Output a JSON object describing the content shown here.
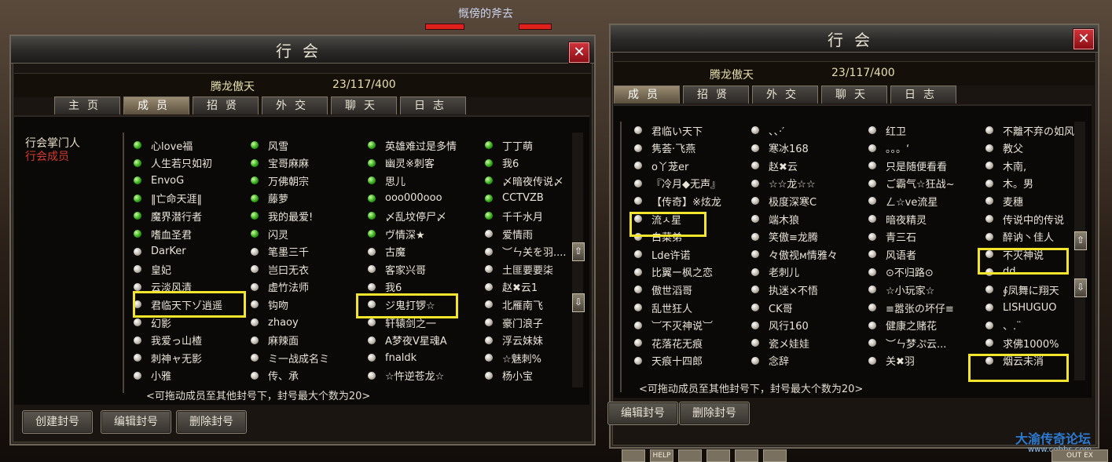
{
  "top_character_name": "慨傍的斧去",
  "left": {
    "title": "行会",
    "close": "✕",
    "guild_name": "腾龙傲天",
    "guild_count": "23/117/400",
    "tabs": [
      "主页",
      "成员",
      "招贤",
      "外交",
      "聊天",
      "日志"
    ],
    "roles": {
      "leader": "行会掌门人",
      "member": "行会成员"
    },
    "members": [
      {
        "name": "心love福",
        "online": true
      },
      {
        "name": "风雪",
        "online": true
      },
      {
        "name": "英雄难过是多情",
        "online": true
      },
      {
        "name": "丁丁萌",
        "online": true
      },
      {
        "name": "人生若只如初",
        "online": true
      },
      {
        "name": "宝哥麻麻",
        "online": true
      },
      {
        "name": "幽灵※刺客",
        "online": true
      },
      {
        "name": "我6",
        "online": true
      },
      {
        "name": "EnvoG",
        "online": true
      },
      {
        "name": "万佛朝宗",
        "online": true
      },
      {
        "name": "思儿",
        "online": true
      },
      {
        "name": "〆暗夜传说〆",
        "online": true
      },
      {
        "name": "‖亡命天涯‖",
        "online": true
      },
      {
        "name": "藤萝",
        "online": true
      },
      {
        "name": "ooo000ooo",
        "online": true
      },
      {
        "name": "CCTVZB",
        "online": true
      },
      {
        "name": "魔界潜行者",
        "online": true
      },
      {
        "name": "我的最爱!",
        "online": true
      },
      {
        "name": "〆乱坟停尸〆",
        "online": true
      },
      {
        "name": "千千水月",
        "online": true
      },
      {
        "name": "嗜血圣君",
        "online": true
      },
      {
        "name": "闪灵",
        "online": true
      },
      {
        "name": "ヴ情深★",
        "online": true
      },
      {
        "name": "爱情雨",
        "online": false
      },
      {
        "name": "DarKer",
        "online": false
      },
      {
        "name": "笔墨三千",
        "online": false
      },
      {
        "name": "古魔",
        "online": false
      },
      {
        "name": "︶ㄣ关を羽....",
        "online": false
      },
      {
        "name": "皇妃",
        "online": false
      },
      {
        "name": "岂曰无衣",
        "online": false
      },
      {
        "name": "客家兴哥",
        "online": false
      },
      {
        "name": "土匪要要柒",
        "online": false
      },
      {
        "name": "云淡风清",
        "online": false
      },
      {
        "name": "虚竹法师",
        "online": false
      },
      {
        "name": "我6",
        "online": false
      },
      {
        "name": "赵✖云1",
        "online": false
      },
      {
        "name": "君临天下ゾ逍遥",
        "online": false
      },
      {
        "name": "钩吻",
        "online": false
      },
      {
        "name": "ジ鬼打锣☆",
        "online": false
      },
      {
        "name": "北雁南飞",
        "online": false
      },
      {
        "name": "幻影",
        "online": false
      },
      {
        "name": "zhaoy",
        "online": false
      },
      {
        "name": "轩辕剑之一",
        "online": false
      },
      {
        "name": "豪门浪子",
        "online": false
      },
      {
        "name": "我爱っ山楂",
        "online": false
      },
      {
        "name": "麻辣面",
        "online": false
      },
      {
        "name": "A梦夜V星魂A",
        "online": false
      },
      {
        "name": "浮云妹妹",
        "online": false
      },
      {
        "name": "刺神ャ无影",
        "online": false
      },
      {
        "name": "ミ一战成名ミ",
        "online": false
      },
      {
        "name": "fnaldk",
        "online": false
      },
      {
        "name": "☆魅刺%",
        "online": false
      },
      {
        "name": "小雅",
        "online": false
      },
      {
        "name": "传、承",
        "online": false
      },
      {
        "name": "☆忤逆苍龙☆",
        "online": false
      },
      {
        "name": "杨小宝",
        "online": false
      }
    ],
    "hint": "<可拖动成员至其他封号下，封号最大个数为20>",
    "buttons": [
      "创建封号",
      "编辑封号",
      "删除封号"
    ],
    "scroll_up": "⇧",
    "scroll_down": "⇩"
  },
  "right": {
    "title": "行会",
    "close": "✕",
    "guild_name": "腾龙傲天",
    "guild_count": "23/117/400",
    "tabs": [
      "成员",
      "招贤",
      "外交",
      "聊天",
      "日志"
    ],
    "members": [
      {
        "name": "君临い天下",
        "online": false
      },
      {
        "name": "、、·′",
        "online": false
      },
      {
        "name": "红卫",
        "online": false
      },
      {
        "name": "不離不弃の如风",
        "online": false
      },
      {
        "name": "隽荟·飞燕",
        "online": false
      },
      {
        "name": "寒冰168",
        "online": false
      },
      {
        "name": "。。。‘",
        "online": false
      },
      {
        "name": "教父",
        "online": false
      },
      {
        "name": "o丫茏er",
        "online": false
      },
      {
        "name": "赵✖云",
        "online": false
      },
      {
        "name": "只是随便看看",
        "online": false
      },
      {
        "name": "木南,",
        "online": false
      },
      {
        "name": "『冷月◆无声』",
        "online": false
      },
      {
        "name": "☆☆龙☆☆",
        "online": false
      },
      {
        "name": "ご霸气☆狂战~",
        "online": false
      },
      {
        "name": "木。男",
        "online": false
      },
      {
        "name": "【传奇】※炫龙",
        "online": false
      },
      {
        "name": "极度深寒C",
        "online": false
      },
      {
        "name": "ㄥ☆ve流星",
        "online": false
      },
      {
        "name": "麦穗",
        "online": false
      },
      {
        "name": "流ㅅ星",
        "online": false
      },
      {
        "name": "端木狼",
        "online": false
      },
      {
        "name": "暗夜精灵",
        "online": false
      },
      {
        "name": "传说中的传说",
        "online": false
      },
      {
        "name": "白菜弟",
        "online": false
      },
      {
        "name": "笑傲≡龙腾",
        "online": false
      },
      {
        "name": "青三石",
        "online": false
      },
      {
        "name": "醉讷丶佳人",
        "online": false
      },
      {
        "name": "Lde许诺",
        "online": false
      },
      {
        "name": "々傲视м情雅々",
        "online": false
      },
      {
        "name": "风语者",
        "online": false
      },
      {
        "name": "不灭神说",
        "online": false
      },
      {
        "name": "比翼ー枫之恋",
        "online": false
      },
      {
        "name": "老刺儿",
        "online": false
      },
      {
        "name": "⊙不归路⊙",
        "online": false
      },
      {
        "name": "dd",
        "online": false
      },
      {
        "name": "傲世滔哥",
        "online": false
      },
      {
        "name": "执迷×不悟",
        "online": false
      },
      {
        "name": "☆小玩家☆",
        "online": false
      },
      {
        "name": "∮凤舞に翔天",
        "online": false
      },
      {
        "name": "乱世狂人",
        "online": false
      },
      {
        "name": "CK哥",
        "online": false
      },
      {
        "name": "≡嚣张の坏仔≡",
        "online": false
      },
      {
        "name": "LISHUGUO",
        "online": false
      },
      {
        "name": "︺不灭神说︺",
        "online": false
      },
      {
        "name": "风行160",
        "online": false
      },
      {
        "name": "健康之赌花",
        "online": false
      },
      {
        "name": "、.¨",
        "online": false
      },
      {
        "name": "花落花无痕",
        "online": false
      },
      {
        "name": "瓷メ娃娃",
        "online": false
      },
      {
        "name": "︶ㄣ梦ぷ云...",
        "online": false
      },
      {
        "name": "求佛1000%",
        "online": false
      },
      {
        "name": "天痕十四郎",
        "online": false
      },
      {
        "name": "念辞",
        "online": false
      },
      {
        "name": "关✖羽",
        "online": false
      },
      {
        "name": "烟云未消",
        "online": false
      }
    ],
    "hint": "<可拖动成员至其他封号下，封号最大个数为20>",
    "buttons": [
      "编辑封号",
      "删除封号"
    ],
    "scroll_up": "⇧",
    "scroll_down": "⇩"
  },
  "watermark": {
    "title": "大渝传奇论坛",
    "url": "www.cqbbs.com"
  },
  "bottom_toolbar": [
    "",
    "HELP",
    "",
    "",
    "",
    ""
  ],
  "bottom_right": "OUT EX"
}
